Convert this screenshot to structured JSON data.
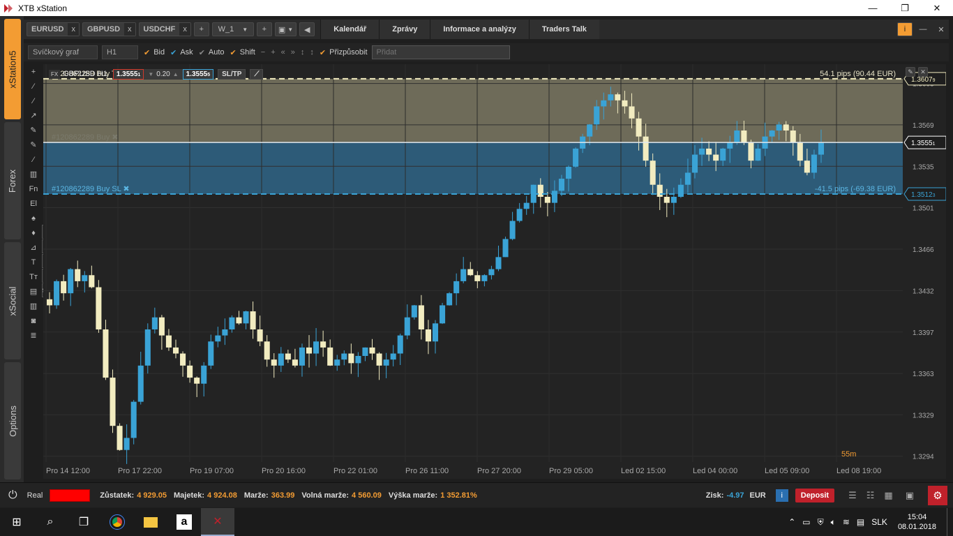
{
  "window": {
    "title": "XTB xStation",
    "min": "—",
    "max": "❐",
    "close": "✕"
  },
  "rail": {
    "tabs": [
      "xStation5",
      "Forex",
      "xSocial",
      "Options"
    ]
  },
  "tabs": {
    "symbols": [
      {
        "label": "EURUSD",
        "close": "x"
      },
      {
        "label": "GBPUSD",
        "close": "x"
      },
      {
        "label": "USDCHF",
        "close": "x"
      }
    ],
    "add": "+",
    "workspace": "W_1",
    "nav": [
      "Kalendář",
      "Zprávy",
      "Informace a analýzy",
      "Traders Talk"
    ]
  },
  "toolbar": {
    "chart_type": "Svíčkový graf",
    "timeframe": "H1",
    "checks": [
      {
        "label": "Bid",
        "on": true
      },
      {
        "label": "Ask",
        "on": true
      },
      {
        "label": "Auto",
        "on": false
      },
      {
        "label": "Shift",
        "on": true
      }
    ],
    "customize": "Přizpůsobit",
    "add_placeholder": "Přidat"
  },
  "drawtools": [
    "+",
    "⁄",
    "⁄",
    "↗",
    "✎",
    "✎",
    "⁄",
    "▥",
    "Fn",
    "El",
    "♠",
    "♦",
    "⊿",
    "T",
    "Tт",
    "▤",
    "▥",
    "◙",
    "≣"
  ],
  "flyout": [
    "✎",
    "▥",
    "▢",
    "▣",
    "Sl/Tp"
  ],
  "chart_header": {
    "market": "FX",
    "symbol": "GBPUSD H1",
    "bid": "1.3555",
    "bid_small": "1",
    "spread": "0.20",
    "ask": "1.3555",
    "ask_small": "5",
    "sltp": "SL/TP"
  },
  "chart_data": {
    "type": "candlestick",
    "symbol": "GBPUSD",
    "timeframe": "H1",
    "ylim": [
      1.329,
      1.362
    ],
    "y_ticks": [
      "1.3294",
      "1.3329",
      "1.3363",
      "1.3397",
      "1.3432",
      "1.3466",
      "1.3501",
      "1.3535",
      "1.3569",
      "1.3603"
    ],
    "y_tick_values": [
      1.32948,
      1.33292,
      1.33634,
      1.33978,
      1.34322,
      1.34666,
      1.3501,
      1.35353,
      1.35697,
      1.3604
    ],
    "x_ticks": [
      "Pro 14 12:00",
      "Pro 17 22:00",
      "Pro 19 07:00",
      "Pro 20 16:00",
      "Pro 22 01:00",
      "Pro 26 11:00",
      "Pro 27 20:00",
      "Pro 29 05:00",
      "Led 02 15:00",
      "Led 04 00:00",
      "Led 05 09:00",
      "Led 08 19:00"
    ],
    "closes": [
      1.342,
      1.344,
      1.343,
      1.345,
      1.344,
      1.3445,
      1.3435,
      1.34,
      1.336,
      1.332,
      1.33,
      1.331,
      1.334,
      1.337,
      1.34,
      1.341,
      1.3395,
      1.3385,
      1.338,
      1.337,
      1.336,
      1.3355,
      1.337,
      1.339,
      1.3395,
      1.34,
      1.341,
      1.3405,
      1.3415,
      1.34,
      1.339,
      1.3375,
      1.337,
      1.338,
      1.3375,
      1.337,
      1.3385,
      1.338,
      1.339,
      1.3385,
      1.337,
      1.3375,
      1.338,
      1.3372,
      1.3378,
      1.3385,
      1.338,
      1.337,
      1.3375,
      1.338,
      1.3395,
      1.341,
      1.342,
      1.34,
      1.339,
      1.3405,
      1.342,
      1.343,
      1.344,
      1.345,
      1.3445,
      1.344,
      1.3445,
      1.345,
      1.346,
      1.3475,
      1.349,
      1.35,
      1.3505,
      1.352,
      1.351,
      1.3505,
      1.3515,
      1.3525,
      1.3535,
      1.355,
      1.356,
      1.357,
      1.3585,
      1.359,
      1.3595,
      1.359,
      1.3585,
      1.3575,
      1.356,
      1.354,
      1.352,
      1.351,
      1.3505,
      1.351,
      1.352,
      1.353,
      1.3545,
      1.355,
      1.3545,
      1.354,
      1.355,
      1.3555,
      1.3565,
      1.3555,
      1.354,
      1.355,
      1.356,
      1.3565,
      1.357,
      1.3565,
      1.3555,
      1.354,
      1.353,
      1.3545,
      1.3555
    ],
    "trade": {
      "id": "#120862289 Buy",
      "tp_label": "#120862289 Buy  TP",
      "sl_label": "#120862289 Buy  SL",
      "open_label": "#120862289 Buy",
      "tp_price": "1.3607",
      "tp_small": "9",
      "tp_value": 1.36079,
      "open_value": 1.35551,
      "sl_value": 1.35123,
      "current_price": "1.3555",
      "current_small": "1",
      "sl_price": "1.3512",
      "sl_small": "3",
      "tp_text": "54.1 pips (90.44 EUR)",
      "sl_text": "-41.5 pips (-69.38 EUR)"
    },
    "countdown": "55m",
    "colors": {
      "bull": "#3aa3d6",
      "bear": "#f2ecc0",
      "tp_zone": "#6e6b59",
      "sl_zone": "#2d5b78"
    }
  },
  "status": {
    "account": "Real",
    "balance_label": "Zůstatek:",
    "balance": "4 929.05",
    "equity_label": "Majetek:",
    "equity": "4 924.08",
    "margin_label": "Marže:",
    "margin": "363.99",
    "free_margin_label": "Volná marže:",
    "free_margin": "4 560.09",
    "margin_level_label": "Výška marže:",
    "margin_level": "1 352.81%",
    "profit_label": "Zisk:",
    "profit": "-4.97",
    "currency": "EUR",
    "deposit": "Deposit"
  },
  "taskbar": {
    "lang": "SLK",
    "time": "15:04",
    "date": "08.01.2018"
  }
}
